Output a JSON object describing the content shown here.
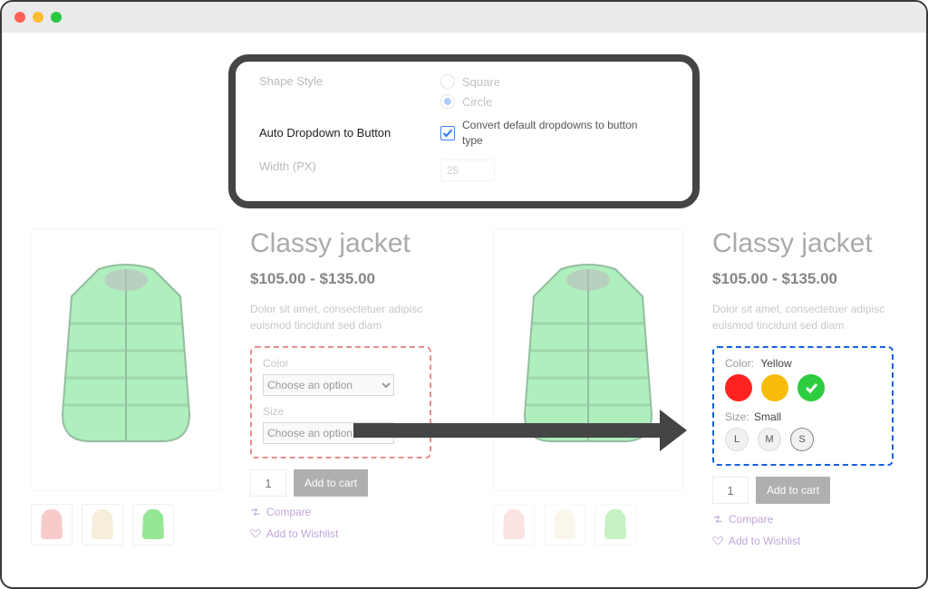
{
  "settings": {
    "shape_style_label": "Shape Style",
    "shape_option_square": "Square",
    "shape_option_circle": "Circle",
    "auto_dropdown_label": "Auto Dropdown to Button",
    "auto_dropdown_desc": "Convert default dropdowns to button type",
    "width_label": "Width (PX)",
    "width_value": "25"
  },
  "product_left": {
    "title": "Classy jacket",
    "price": "$105.00 - $135.00",
    "desc": "Dolor sit amet, consectetuer adipisc euismod tincidunt sed diam",
    "color_label": "Color",
    "color_placeholder": "Choose an option",
    "size_label": "Size",
    "size_placeholder": "Choose an option",
    "qty": "1",
    "add_to_cart": "Add to cart",
    "compare": "Compare",
    "wishlist": "Add to Wishlist"
  },
  "product_right": {
    "title": "Classy jacket",
    "price": "$105.00 - $135.00",
    "desc": "Dolor sit amet, consectetuer adipisc euismod tincidunt sed diam",
    "color_label": "Color:",
    "color_value": "Yellow",
    "size_label": "Size:",
    "size_value": "Small",
    "sizes": [
      "L",
      "M",
      "S"
    ],
    "qty": "1",
    "add_to_cart": "Add to cart",
    "compare": "Compare",
    "wishlist": "Add to Wishlist"
  }
}
